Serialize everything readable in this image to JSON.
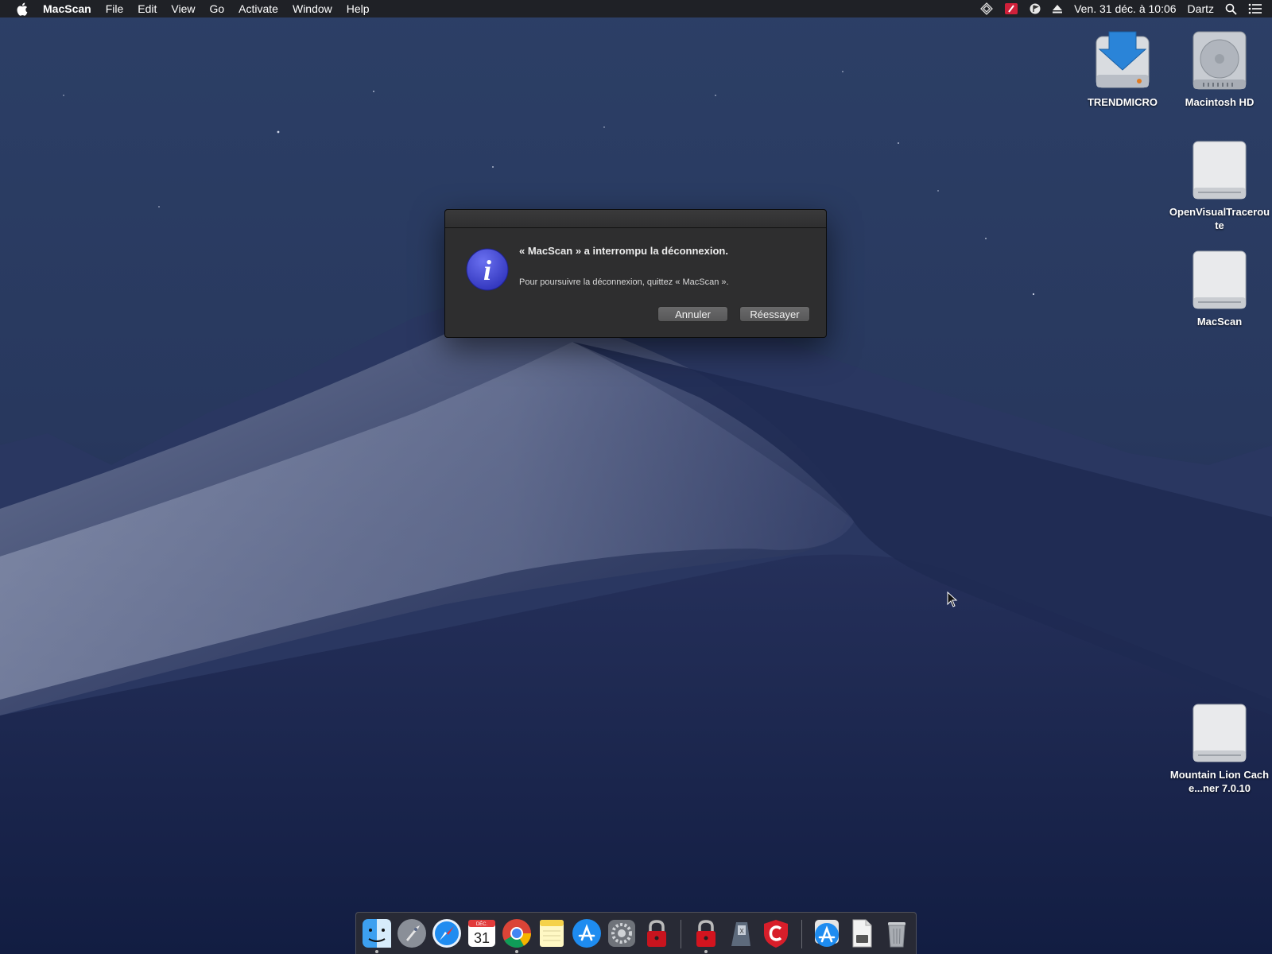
{
  "menubar": {
    "app_name": "MacScan",
    "menus": [
      "File",
      "Edit",
      "View",
      "Go",
      "Activate",
      "Window",
      "Help"
    ],
    "clock": "Ven. 31 déc. à 10:06",
    "user": "Dartz"
  },
  "desktop": {
    "icons": [
      {
        "label": "TRENDMICRO",
        "icon": "installer-disk-icon"
      },
      {
        "label": "Macintosh HD",
        "icon": "hard-disk-icon"
      },
      {
        "label": "OpenVisualTraceroute",
        "icon": "external-disk-icon"
      },
      {
        "label": "MacScan",
        "icon": "external-disk-icon"
      },
      {
        "label": "Mountain Lion Cache...ner 7.0.10",
        "icon": "external-disk-icon"
      }
    ]
  },
  "dialog": {
    "title": "« MacScan » a interrompu la déconnexion.",
    "message": "Pour poursuivre la déconnexion, quittez « MacScan ».",
    "cancel_label": "Annuler",
    "retry_label": "Réessayer",
    "icon": "info-icon",
    "icon_color": "#3b3fd0"
  },
  "dock": {
    "calendar_month": "DÉC.",
    "calendar_day": "31",
    "items": [
      "finder",
      "launchpad",
      "safari",
      "calendar",
      "chrome",
      "notes",
      "app-store",
      "system-preferences",
      "lock-app",
      "lock-app-2",
      "script-app",
      "c-shield",
      "app-store-folder",
      "documents-folder",
      "trash"
    ]
  }
}
